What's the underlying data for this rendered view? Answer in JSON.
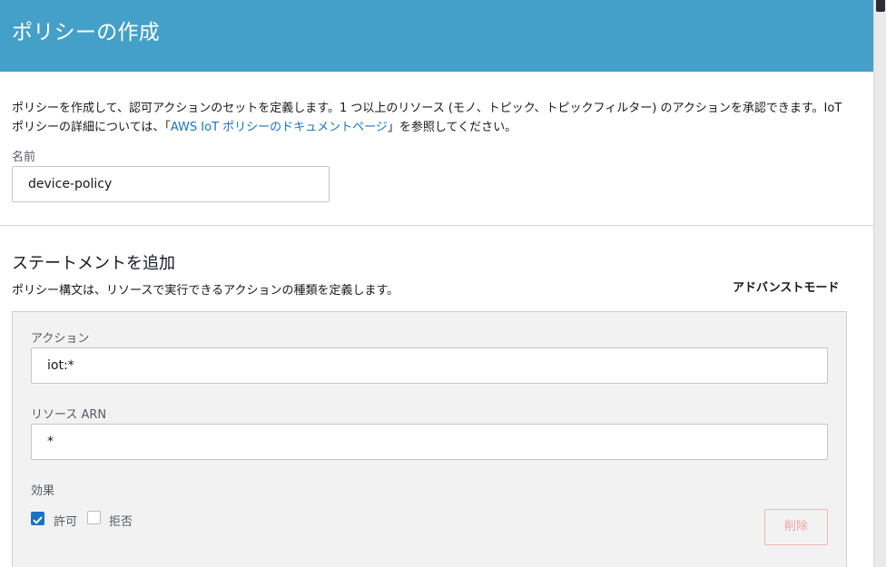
{
  "header": {
    "title": "ポリシーの作成"
  },
  "intro": {
    "text_before": "ポリシーを作成して、認可アクションのセットを定義します。1 つ以上のリソース (モノ、トピック、トピックフィルター) のアクションを承認できます。IoT ポリシーの詳細については、「",
    "link": "AWS IoT ポリシーのドキュメントページ",
    "text_after": "」を参照してください。"
  },
  "name_field": {
    "label": "名前",
    "value": "device-policy"
  },
  "statement": {
    "title": "ステートメントを追加",
    "subtitle": "ポリシー構文は、リソースで実行できるアクションの種類を定義します。",
    "advanced_mode": "アドバンストモード",
    "action": {
      "label": "アクション",
      "value": "iot:*"
    },
    "resource": {
      "label": "リソース ARN",
      "value": "*"
    },
    "effect": {
      "label": "効果",
      "allow": {
        "label": "許可",
        "checked": true
      },
      "deny": {
        "label": "拒否",
        "checked": false
      }
    },
    "delete_label": "削除"
  },
  "colors": {
    "header_bg": "#44a0c8",
    "link": "#1a73c5",
    "checkbox_checked": "#1a73c5",
    "delete_button": "#f1a3a3"
  },
  "icons": {
    "allow_checkbox": "checkmark-icon"
  }
}
